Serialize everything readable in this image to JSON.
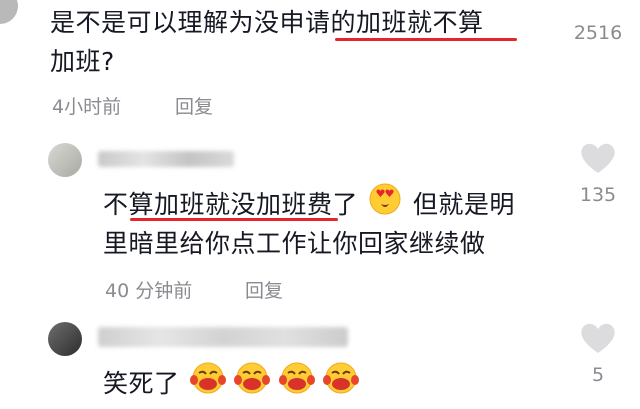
{
  "colors": {
    "text": "#161823",
    "meta": "#8a8b91",
    "heart": "#dcdcdf",
    "underline": "#e4262c"
  },
  "comments": [
    {
      "text_line1": "是不是可以理解为没申请的加班就不算",
      "text_line2": "加班?",
      "time": "4小时前",
      "reply_label": "回复",
      "likes": "2516",
      "heart_icon": "heart-outline-icon"
    },
    {
      "text_line1_a": "不算加班就没加班费了",
      "text_line1_b": "但就是明",
      "text_line2": "里暗里给你点工作让你回家继续做",
      "time": "40 分钟前",
      "reply_label": "回复",
      "likes": "135",
      "emoji_icon": "heart-eyes-emoji",
      "heart_icon": "heart-outline-icon"
    },
    {
      "text": "笑死了",
      "emoji_icons": [
        "laughing-crying-emoji",
        "laughing-crying-emoji",
        "laughing-crying-emoji",
        "laughing-crying-emoji"
      ],
      "likes": "5",
      "heart_icon": "heart-outline-icon"
    }
  ]
}
